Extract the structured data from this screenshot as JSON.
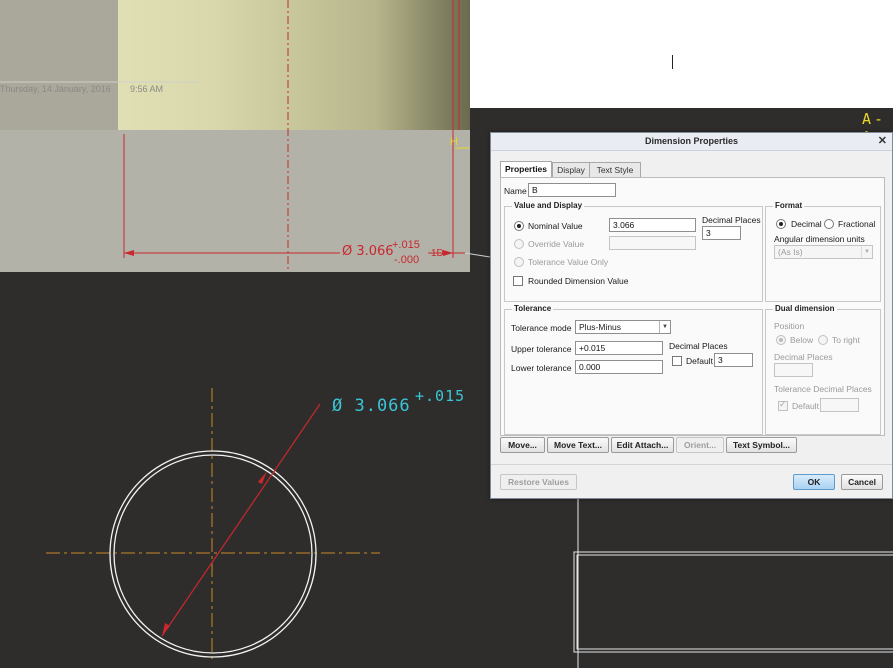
{
  "canvas": {
    "overlay_date": "Thursday, 14 January, 2016",
    "overlay_time": "9:56 AM",
    "section_label": "A-A",
    "top_dim": {
      "value": "Ø 3.066",
      "upper": "+.015",
      "lower": "-.000",
      "suffix": "1D"
    },
    "top_small_label": "H",
    "bottom_dim": {
      "value": "Ø 3.066",
      "upper": "+.015"
    },
    "colors": {
      "background": "#2e2d2b",
      "dimension_red": "#c8282e",
      "dimension_cyan": "#39c6d8",
      "centerline_orange": "#c8892a",
      "section_yellow": "#e8d72a",
      "part_face": "#d8d6ae"
    }
  },
  "dialog": {
    "title": "Dimension Properties",
    "close_icon": "close-icon",
    "tabs": [
      "Properties",
      "Display",
      "Text Style"
    ],
    "name_label": "Name",
    "name_value": "B",
    "value_display": {
      "title": "Value and Display",
      "nominal_label": "Nominal Value",
      "nominal_value": "3.066",
      "override_label": "Override Value",
      "override_value": "",
      "tolerance_only_label": "Tolerance Value Only",
      "decimal_places_label": "Decimal Places",
      "decimal_places_value": "3",
      "rounded_label": "Rounded Dimension Value"
    },
    "format": {
      "title": "Format",
      "decimal_label": "Decimal",
      "fractional_label": "Fractional",
      "angular_label": "Angular dimension units",
      "angular_value": "(As Is)"
    },
    "tolerance": {
      "title": "Tolerance",
      "mode_label": "Tolerance mode",
      "mode_value": "Plus-Minus",
      "upper_label": "Upper tolerance",
      "upper_value": "+0.015",
      "lower_label": "Lower tolerance",
      "lower_value": "0.000",
      "decimal_places_label": "Decimal Places",
      "default_label": "Default",
      "decimal_places_value": "3"
    },
    "dual": {
      "title": "Dual dimension",
      "position_label": "Position",
      "below_label": "Below",
      "right_label": "To right",
      "decimal_places_label": "Decimal Places",
      "tol_decimal_label": "Tolerance Decimal Places",
      "default_label": "Default"
    },
    "buttons": {
      "move": "Move...",
      "move_text": "Move Text...",
      "edit_attach": "Edit Attach...",
      "orient": "Orient...",
      "text_symbol": "Text Symbol...",
      "restore": "Restore Values",
      "ok": "OK",
      "cancel": "Cancel"
    }
  }
}
